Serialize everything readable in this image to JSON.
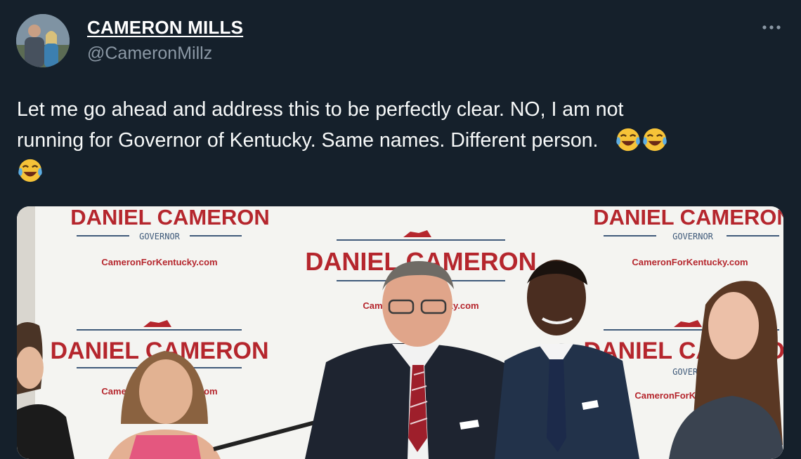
{
  "author": {
    "display_name": "CAMERON MILLS",
    "handle": "@CameronMillz",
    "avatar_icon": "profile-photo"
  },
  "more_icon": "more-icon",
  "tweet": {
    "line1": "Let me go ahead and address this to be perfectly clear. NO, I am not",
    "line2": "running for Governor of Kentucky. Same names. Different person.",
    "emoji": "face-with-tears-of-joy"
  },
  "media": {
    "backdrop": {
      "name": "DANIEL CAMERON",
      "office": "GOVERNOR",
      "site": "CameronForKentucky.com"
    }
  },
  "colors": {
    "background": "#15202b",
    "secondary_text": "#8b98a5",
    "banner_red": "#b5262d"
  }
}
